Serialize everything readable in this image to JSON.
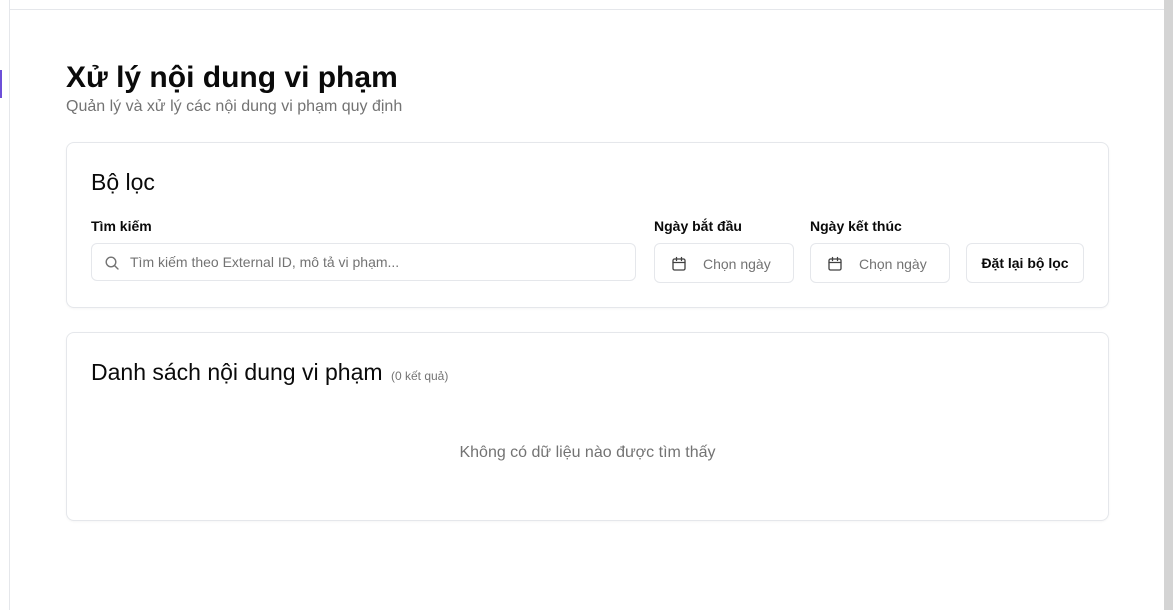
{
  "header": {
    "title": "Xử lý nội dung vi phạm",
    "subtitle": "Quản lý và xử lý các nội dung vi phạm quy định"
  },
  "filters": {
    "title": "Bộ lọc",
    "search": {
      "label": "Tìm kiếm",
      "placeholder": "Tìm kiếm theo External ID, mô tả vi phạm...",
      "value": ""
    },
    "start_date": {
      "label": "Ngày bắt đầu",
      "placeholder": "Chọn ngày",
      "icon": "calendar-icon"
    },
    "end_date": {
      "label": "Ngày kết thúc",
      "placeholder": "Chọn ngày",
      "icon": "calendar-icon"
    },
    "reset_label": "Đặt lại bộ lọc"
  },
  "list": {
    "title": "Danh sách nội dung vi phạm",
    "count_text": "(0 kết quả)",
    "empty_text": "Không có dữ liệu nào được tìm thấy"
  },
  "colors": {
    "accent": "#6d4fd8",
    "border": "#e5e7eb",
    "muted_text": "#737373",
    "text": "#0a0a0a"
  }
}
